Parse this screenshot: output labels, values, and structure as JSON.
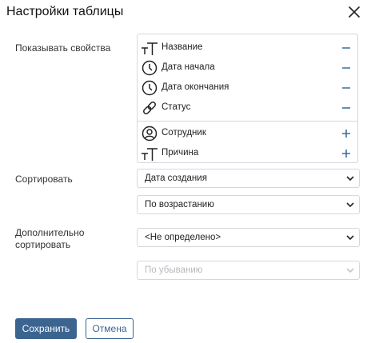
{
  "dialog": {
    "title": "Настройки таблицы"
  },
  "fields": {
    "show_properties_label": "Показывать свойства",
    "sort_label": "Сортировать",
    "additional_sort_label": "Дополнительно сортировать"
  },
  "properties": {
    "shown": [
      {
        "label": "Название",
        "icon": "text-type-icon"
      },
      {
        "label": "Дата начала",
        "icon": "clock-icon"
      },
      {
        "label": "Дата окончания",
        "icon": "clock-icon"
      },
      {
        "label": "Статус",
        "icon": "link-icon"
      }
    ],
    "hidden": [
      {
        "label": "Сотрудник",
        "icon": "user-icon"
      },
      {
        "label": "Причина",
        "icon": "text-type-icon"
      }
    ]
  },
  "sort": {
    "field_value": "Дата создания",
    "order_value": "По возрастанию"
  },
  "additional_sort": {
    "field_value": "<Не определено>",
    "order_value": "По убыванию"
  },
  "buttons": {
    "save": "Сохранить",
    "cancel": "Отмена"
  },
  "colors": {
    "accent": "#3b6590",
    "action_icon": "#3d6f9e",
    "border": "#d4d7dc",
    "disabled_text": "#b7b9bd"
  }
}
